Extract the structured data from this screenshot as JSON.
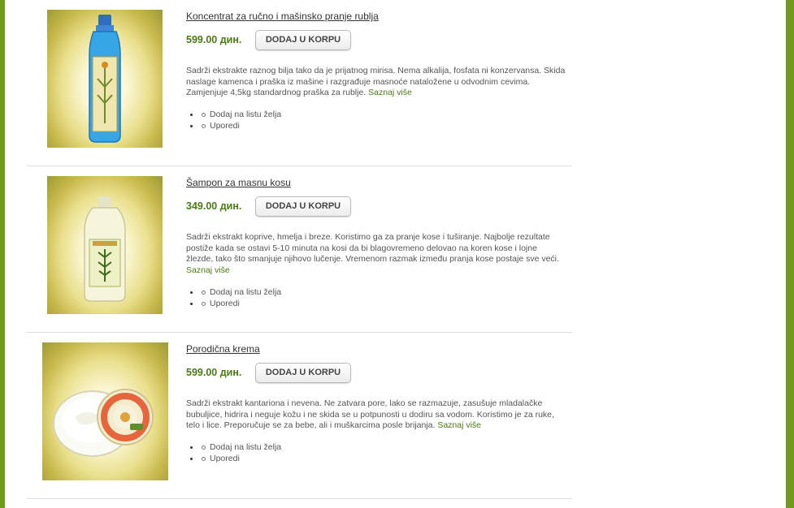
{
  "products": [
    {
      "title": "Koncentrat za ručno i mašinsko pranje rublja",
      "price": "599.00 дин.",
      "button": "DODAJ U KORPU",
      "description": "Sadrži ekstrakte raznog bilja tako da je prijatnog mirisa. Nema alkalija, fosfata ni konzervansa. Skida naslage kamenca i praška iz mašine i razgrađuje masnoće nataložene u odvodnim cevima. Zamjenjuje 4,5kg standardnog praška za rublje.",
      "more": "Saznaj više",
      "actions": [
        "Dodaj na listu želja",
        "Uporedi"
      ]
    },
    {
      "title": "Šampon za masnu kosu",
      "price": "349.00 дин.",
      "button": "DODAJ U KORPU",
      "description": "Sadrži ekstrakt koprive, hmelja i breze. Koristimo ga za pranje kose i tuširanje. Najbolje rezultate postiže kada se ostavi 5-10 minuta na kosi da bi blagovremeno delovao na koren kose i lojne žlezde, tako što smanjuje njihovo lučenje. Vremenom razmak između pranja kose postaje sve veći.",
      "more": "Saznaj više",
      "actions": [
        "Dodaj na listu želja",
        "Uporedi"
      ]
    },
    {
      "title": "Porodična krema",
      "price": "599.00 дин.",
      "button": "DODAJ U KORPU",
      "description": "Sadrži ekstrakt kantariona i nevena. Ne zatvara pore, lako se razmazuje, zasušuje mladalačke bubuljice, hidrira i neguje kožu i ne skida se u potpunosti u dodiru sa vodom. Koristimo je za ruke, telo i lice. Preporučuje se za bebe, ali i muškarcima posle brijanja.",
      "more": "Saznaj više",
      "actions": [
        "Dodaj na listu želja",
        "Uporedi"
      ]
    }
  ],
  "colors": {
    "background": "#6f9a1c",
    "price": "#4a7b12",
    "link": "#4a7b12"
  }
}
